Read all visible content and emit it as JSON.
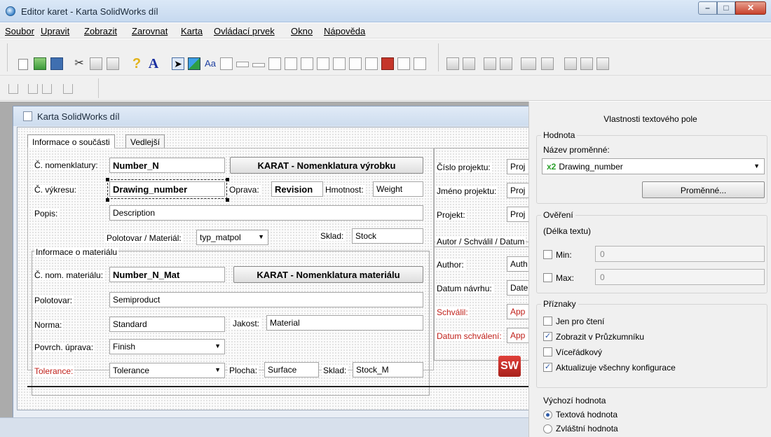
{
  "window": {
    "title": "Editor karet - Karta SolidWorks díl"
  },
  "menu": [
    "Soubor",
    "Upravit",
    "Zobrazit",
    "Zarovnat",
    "Karta",
    "Ovládací prvek",
    "Okno",
    "Nápověda"
  ],
  "child_window": {
    "title": "Karta SolidWorks díl"
  },
  "tabs": [
    "Informace o součásti",
    "Vedlejší"
  ],
  "form": {
    "nomenklatury_label": "Č. nomenklatury:",
    "nomenklatury_value": "Number_N",
    "karat_vyrobku_button": "KARAT - Nomenklatura výrobku",
    "vykresu_label": "Č. výkresu:",
    "vykresu_value": "Drawing_number",
    "oprava_label": "Oprava:",
    "oprava_value": "Revision",
    "hmotnost_label": "Hmotnost:",
    "hmotnost_value": "Weight",
    "popis_label": "Popis:",
    "popis_value": "Description",
    "polotovar_material_label": "Polotovar / Materiál:",
    "polotovar_material_value": "typ_matpol",
    "sklad_label": "Sklad:",
    "sklad_value": "Stock",
    "material_group": "Informace o materiálu",
    "nom_materialu_label": "Č. nom. materiálu:",
    "nom_materialu_value": "Number_N_Mat",
    "karat_materialu_button": "KARAT - Nomenklatura materiálu",
    "polotovar_label": "Polotovar:",
    "polotovar_value": "Semiproduct",
    "norma_label": "Norma:",
    "norma_value": "Standard",
    "jakost_label": "Jakost:",
    "jakost_value": "Material",
    "povrch_label": "Povrch. úprava:",
    "povrch_value": "Finish",
    "tolerance_label": "Tolerance:",
    "tolerance_value": "Tolerance",
    "plocha_label": "Plocha:",
    "plocha_value": "Surface",
    "sklad2_label": "Sklad:",
    "sklad2_value": "Stock_M",
    "cislo_projektu_label": "Číslo projektu:",
    "cislo_projektu_value": "Proj",
    "jmeno_projektu_label": "Jméno projektu:",
    "jmeno_projektu_value": "Proj",
    "projekt_label": "Projekt:",
    "projekt_value": "Proj",
    "autor_group": "Autor / Schválil / Datum",
    "author_label": "Author:",
    "author_value": "Auth",
    "datum_navrhu_label": "Datum návrhu:",
    "datum_navrhu_value": "Date",
    "schvalil_label": "Schválil:",
    "schvalil_value": "App",
    "datum_schvaleni_label": "Datum schválení:",
    "datum_schvaleni_value": "App",
    "logo_text": "SW"
  },
  "props": {
    "header": "Vlastnosti textového pole",
    "hodnota": "Hodnota",
    "nazev_promenne": "Název proměnné:",
    "combo_prefix": "x2",
    "combo_value": "Drawing_number",
    "promenne_button": "Proměnné...",
    "overeni": "Ověření",
    "delka_textu": "(Délka textu)",
    "min_label": "Min:",
    "min_value": "0",
    "max_label": "Max:",
    "max_value": "0",
    "priznaky": "Příznaky",
    "jen_pro_cteni": "Jen pro čtení",
    "zobrazit": "Zobrazit v Průzkumníku",
    "viceradkovy": "Víceřádkový",
    "aktualizuje": "Aktualizuje všechny konfigurace",
    "vychozi_hodnota": "Výchozí hodnota",
    "textova_hodnota": "Textová hodnota",
    "zvlastni_hodnota": "Zvláštní hodnota"
  }
}
